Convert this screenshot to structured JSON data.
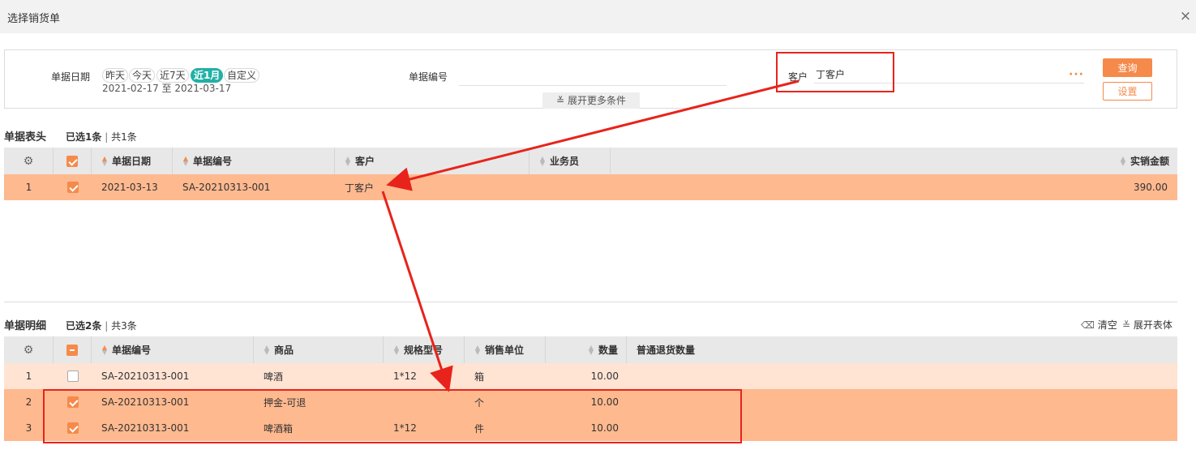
{
  "dialog": {
    "title": "选择销货单",
    "close_icon": "×"
  },
  "filter": {
    "date_label": "单据日期",
    "date_chips": [
      "昨天",
      "今天",
      "近7天",
      "近1月",
      "自定义"
    ],
    "active_chip": "近1月",
    "date_range": "2021-02-17 至 2021-03-17",
    "doc_no_label": "单据编号",
    "doc_no_value": "",
    "customer_label": "客户",
    "customer_value": "丁客户",
    "more_conditions": "展开更多条件",
    "more_icon": "···",
    "query_label": "查询",
    "settings_label": "设置"
  },
  "header_section": {
    "title": "单据表头",
    "selected_prefix": "已选",
    "selected_count": "1",
    "selected_unit": "条",
    "total": "共1条",
    "columns": {
      "date": "单据日期",
      "doc_no": "单据编号",
      "customer": "客户",
      "salesperson": "业务员",
      "amount": "实销金额"
    },
    "rows": [
      {
        "index": "1",
        "checked": true,
        "date": "2021-03-13",
        "doc_no": "SA-20210313-001",
        "customer": "丁客户",
        "salesperson": "",
        "amount": "390.00"
      }
    ]
  },
  "detail_section": {
    "title": "单据明细",
    "selected_prefix": "已选",
    "selected_count": "2",
    "selected_unit": "条",
    "total": "共3条",
    "clear_label": "清空",
    "expand_label": "展开表体",
    "columns": {
      "doc_no": "单据编号",
      "product": "商品",
      "spec": "规格型号",
      "unit": "销售单位",
      "qty": "数量",
      "return_qty": "普通退货数量"
    },
    "rows": [
      {
        "index": "1",
        "checked": false,
        "doc_no": "SA-20210313-001",
        "product": "啤酒",
        "spec": "1*12",
        "unit": "箱",
        "qty": "10.00",
        "return_qty": ""
      },
      {
        "index": "2",
        "checked": true,
        "doc_no": "SA-20210313-001",
        "product": "押金-可退",
        "spec": "",
        "unit": "个",
        "qty": "10.00",
        "return_qty": ""
      },
      {
        "index": "3",
        "checked": true,
        "doc_no": "SA-20210313-001",
        "product": "啤酒箱",
        "spec": "1*12",
        "unit": "件",
        "qty": "10.00",
        "return_qty": ""
      }
    ]
  },
  "colors": {
    "accent": "#f58a4b",
    "selected_row": "#ffb98f",
    "light_row": "#ffe3d3",
    "active_chip": "#22b0a6",
    "annotation": "#e8231b"
  }
}
